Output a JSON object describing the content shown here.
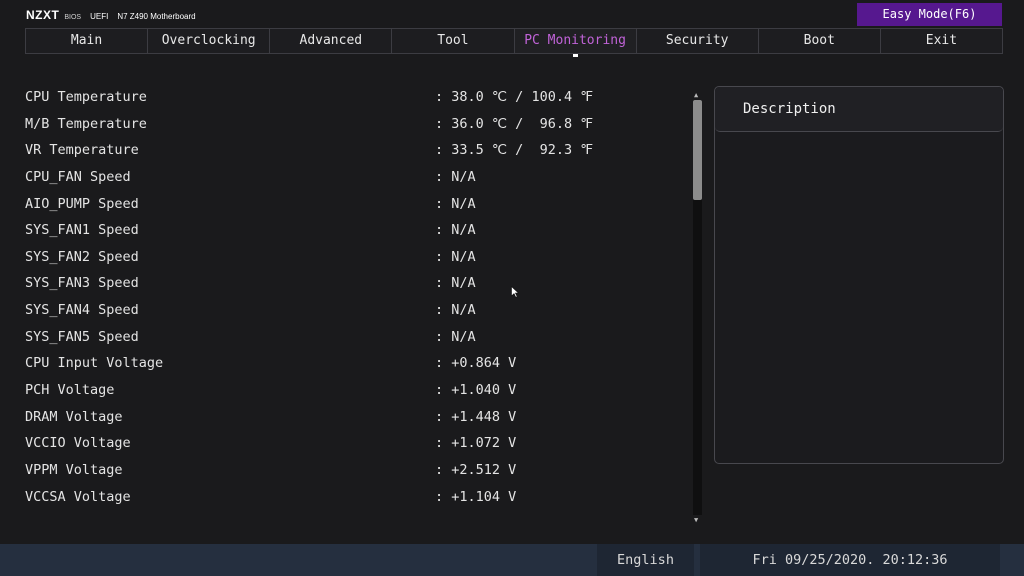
{
  "header": {
    "brand": "NZXT",
    "bios": "BIOS",
    "uefi": "UEFI",
    "board": "N7 Z490 Motherboard",
    "easy_mode": "Easy Mode(F6)"
  },
  "tabs": [
    {
      "label": "Main",
      "active": false
    },
    {
      "label": "Overclocking",
      "active": false
    },
    {
      "label": "Advanced",
      "active": false
    },
    {
      "label": "Tool",
      "active": false
    },
    {
      "label": "PC Monitoring",
      "active": true
    },
    {
      "label": "Security",
      "active": false
    },
    {
      "label": "Boot",
      "active": false
    },
    {
      "label": "Exit",
      "active": false
    }
  ],
  "monitoring": [
    {
      "label": "CPU Temperature",
      "value": ": 38.0 ℃ / 100.4 ℉"
    },
    {
      "label": "M/B Temperature",
      "value": ": 36.0 ℃ /  96.8 ℉"
    },
    {
      "label": "VR Temperature",
      "value": ": 33.5 ℃ /  92.3 ℉"
    },
    {
      "label": "CPU_FAN Speed",
      "value": ": N/A"
    },
    {
      "label": "AIO_PUMP Speed",
      "value": ": N/A"
    },
    {
      "label": "SYS_FAN1 Speed",
      "value": ": N/A"
    },
    {
      "label": "SYS_FAN2 Speed",
      "value": ": N/A"
    },
    {
      "label": "SYS_FAN3 Speed",
      "value": ": N/A"
    },
    {
      "label": "SYS_FAN4 Speed",
      "value": ": N/A"
    },
    {
      "label": "SYS_FAN5 Speed",
      "value": ": N/A"
    },
    {
      "label": "CPU Input Voltage",
      "value": ": +0.864 V"
    },
    {
      "label": "PCH Voltage",
      "value": ": +1.040 V"
    },
    {
      "label": "DRAM Voltage",
      "value": ": +1.448 V"
    },
    {
      "label": "VCCIO Voltage",
      "value": ": +1.072 V"
    },
    {
      "label": "VPPM Voltage",
      "value": ": +2.512 V"
    },
    {
      "label": "VCCSA Voltage",
      "value": ": +1.104 V"
    }
  ],
  "description": {
    "title": "Description"
  },
  "scrollbar": {
    "position_fraction": 0.0,
    "visible_fraction": 0.24
  },
  "footer": {
    "language": "English",
    "datetime": "Fri 09/25/2020. 20:12:36"
  },
  "colors": {
    "accent": "#56188f",
    "active_tab": "#c163d8",
    "footer": "#252f3f"
  },
  "icons": {
    "scroll_up": "scroll-up-arrow-icon",
    "scroll_down": "scroll-down-arrow-icon",
    "cursor": "mouse-pointer-icon"
  }
}
